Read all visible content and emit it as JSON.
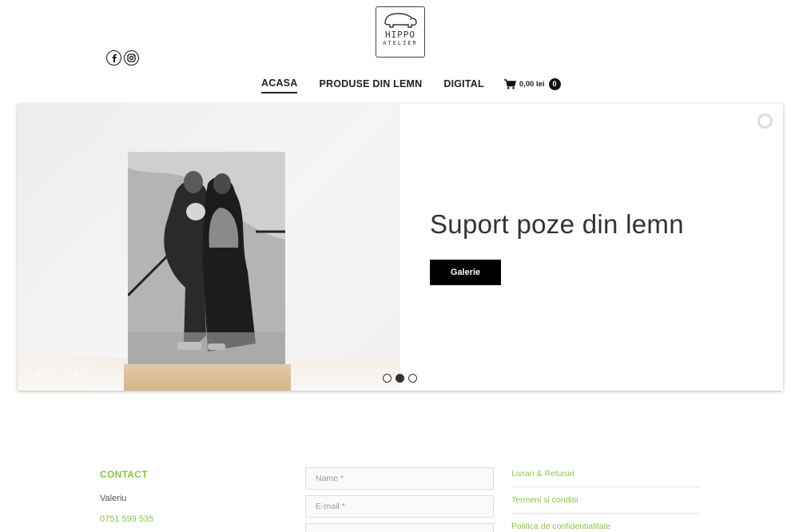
{
  "header": {
    "logo_line1": "HIPPO",
    "logo_line2": "ATELIER",
    "social": [
      "facebook-icon",
      "instagram-icon"
    ]
  },
  "nav": {
    "items": [
      {
        "label": "ACASA",
        "active": true
      },
      {
        "label": "PRODUSE DIN LEMN",
        "active": false
      },
      {
        "label": "DIGITAL",
        "active": false
      }
    ],
    "cart": {
      "icon": "cart-icon",
      "amount": "0,00 lei",
      "count": "0"
    }
  },
  "slider": {
    "title": "Suport poze din lemn",
    "button_label": "Galerie",
    "prev_arrow": "‹",
    "next_arrow": "›",
    "dots": [
      false,
      true,
      false
    ]
  },
  "footer": {
    "contact": {
      "title": "CONTACT",
      "name": "Valeriu",
      "phone": "0751 599 535"
    },
    "form": {
      "name_placeholder": "Name *",
      "email_placeholder": "E-mail *"
    },
    "links": [
      "Livrari & Retururi",
      "Termeni si conditii",
      "Politica de confidentialitate"
    ]
  },
  "colors": {
    "accent_green": "#8bc34a",
    "dark": "#111111"
  }
}
